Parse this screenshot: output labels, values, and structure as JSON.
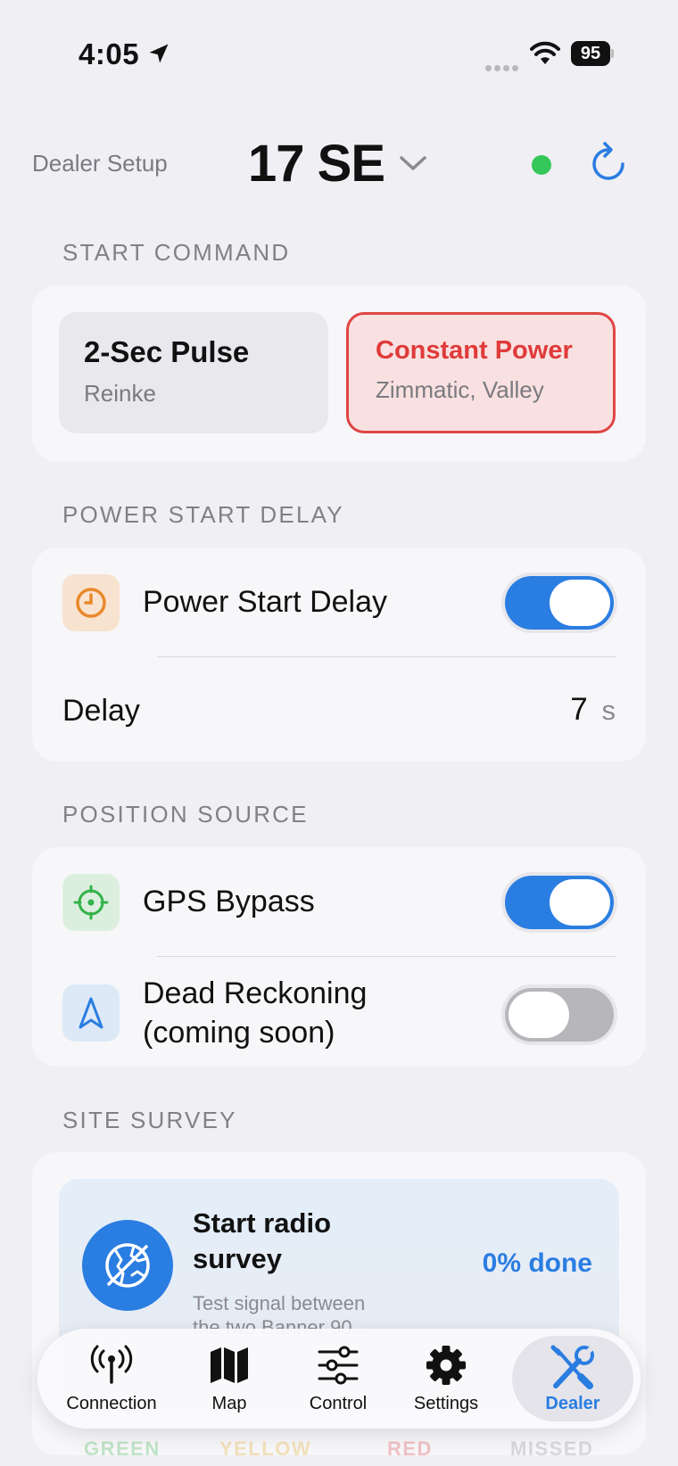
{
  "status_bar": {
    "time": "4:05",
    "battery": "95"
  },
  "header": {
    "left_label": "Dealer Setup",
    "title": "17 SE",
    "connection_color": "#34c759"
  },
  "start_command": {
    "section_label": "START COMMAND",
    "options": [
      {
        "title": "2-Sec Pulse",
        "subtitle": "Reinke",
        "selected": false
      },
      {
        "title": "Constant Power",
        "subtitle": "Zimmatic, Valley",
        "selected": true
      }
    ]
  },
  "power_start_delay": {
    "section_label": "POWER START DELAY",
    "toggle_label": "Power Start Delay",
    "toggle_on": true,
    "delay_label": "Delay",
    "delay_value": "7",
    "delay_unit": "s"
  },
  "position_source": {
    "section_label": "POSITION SOURCE",
    "gps_label": "GPS Bypass",
    "gps_on": true,
    "dead_reckoning_line1": "Dead Reckoning",
    "dead_reckoning_line2": "(coming soon)",
    "dead_reckoning_on": false
  },
  "site_survey": {
    "section_label": "SITE SURVEY",
    "title": "Start radio survey",
    "description_line1": "Test signal between",
    "description_line2": "the two Banner 90...",
    "progress": "0% done",
    "legend": [
      "GREEN",
      "YELLOW",
      "RED",
      "MISSED"
    ]
  },
  "tabs": [
    {
      "label": "Connection",
      "icon": "antenna-icon"
    },
    {
      "label": "Map",
      "icon": "map-icon"
    },
    {
      "label": "Control",
      "icon": "sliders-icon"
    },
    {
      "label": "Settings",
      "icon": "gear-icon"
    },
    {
      "label": "Dealer",
      "icon": "wrench-screwdriver-icon",
      "active": true
    }
  ],
  "colors": {
    "accent": "#2a7de1",
    "danger": "#e03a3a",
    "orange": "#e8892c",
    "green": "#34b34a"
  }
}
